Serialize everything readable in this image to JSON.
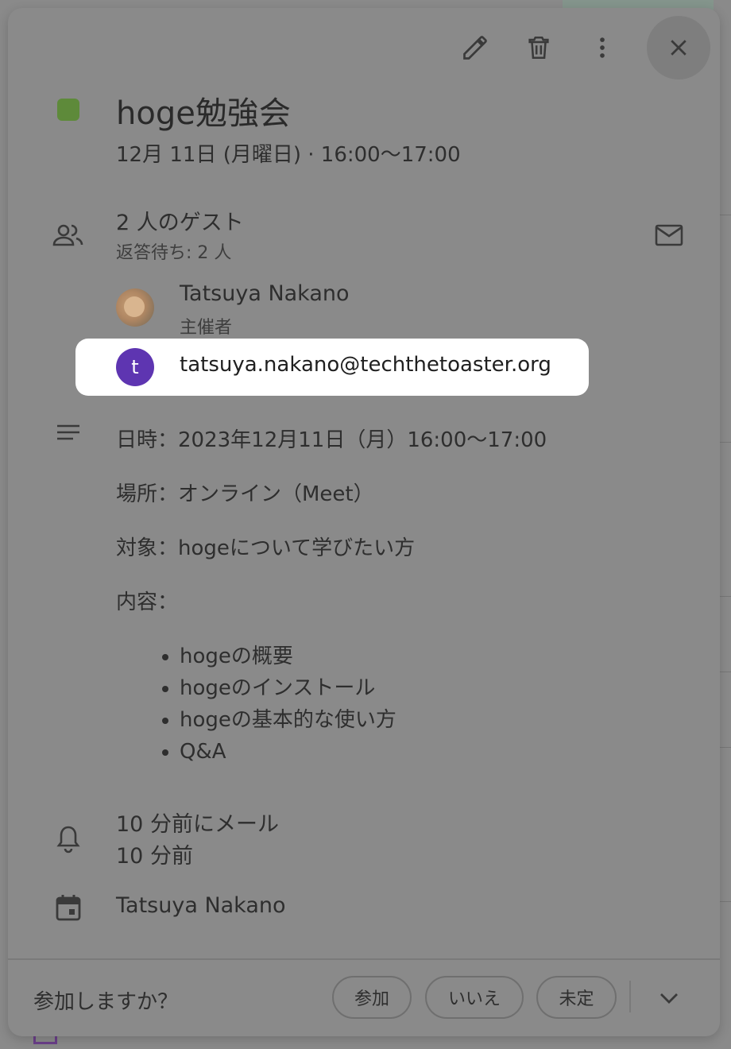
{
  "event": {
    "title": "hoge勉強会",
    "datetime": "12月 11日 (月曜日)  ·  16:00〜17:00",
    "color": "#5e8a3a"
  },
  "toolbar": {
    "edit_icon": "pencil-icon",
    "delete_icon": "trash-icon",
    "more_icon": "more-vert-icon",
    "close_icon": "close-icon"
  },
  "guests": {
    "title": "2 人のゲスト",
    "subtitle": "返答待ち: 2 人",
    "list": [
      {
        "name": "Tatsuya Nakano",
        "role": "主催者"
      },
      {
        "initial": "t",
        "email": "tatsuya.nakano@techthetoaster.org"
      }
    ]
  },
  "description": {
    "lines": [
      "日時：2023年12月11日（月）16:00〜17:00",
      "場所：オンライン（Meet）",
      "対象：hogeについて学びたい方",
      "内容："
    ],
    "bullets": [
      "hogeの概要",
      "hogeのインストール",
      "hogeの基本的な使い方",
      "Q&A"
    ]
  },
  "reminders": [
    "10 分前にメール",
    "10 分前"
  ],
  "calendar_owner": "Tatsuya Nakano",
  "rsvp": {
    "question": "参加しますか？",
    "yes": "参加",
    "no": "いいえ",
    "maybe": "未定"
  }
}
